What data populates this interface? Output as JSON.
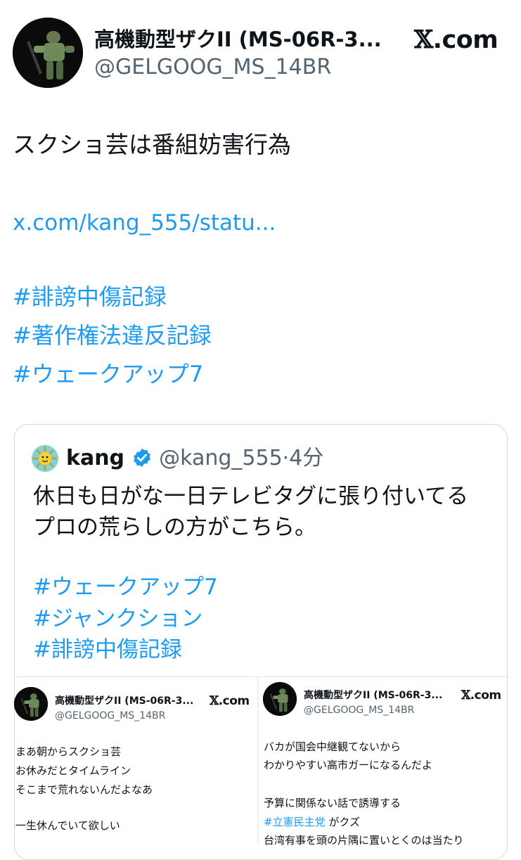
{
  "main_post": {
    "display_name": "高機動型ザクII (MS-06R-3...",
    "handle": "@GELGOOG_MS_14BR",
    "source_brand": ".com",
    "text": "スクショ芸は番組妨害行為",
    "link": "x.com/kang_555/statu...",
    "hashtags": [
      "#誹謗中傷記録",
      "#著作権法違反記録",
      "#ウェークアップ7"
    ]
  },
  "quote": {
    "display_name": "kang",
    "handle": "@kang_555",
    "separator": "·",
    "time": "4分",
    "lines": [
      "休日も日がな一日テレビタグに張り付いてる",
      "プロの荒らしの方がこちら。"
    ],
    "hashtags": [
      "#ウェークアップ7",
      "#ジャンクション",
      "#誹謗中傷記録"
    ]
  },
  "left_screenshot": {
    "display_name": "高機動型ザクII (MS-06R-3...",
    "handle": "@GELGOOG_MS_14BR",
    "source_brand": ".com",
    "lines": [
      "まあ朝からスクショ芸",
      "お休みだとタイムライン",
      "そこまで荒れないんだよなあ",
      "一生休んでいて欲しい"
    ]
  },
  "right_screenshot": {
    "display_name": "高機動型ザクII (MS-06R-3...",
    "handle": "@GELGOOG_MS_14BR",
    "source_brand": ".com",
    "lines": [
      "バカが国会中継観てないから",
      "わかりやすい高市ガーになるんだよ",
      "予算に関係ない話で誘導する"
    ],
    "hashtag": "#立憲民主党",
    "hashtag_suffix": " がクズ",
    "cut_line": "台湾有事を頭の片隅に置いとくのは当たり"
  },
  "colors": {
    "text": "#0f1419",
    "secondary": "#536471",
    "link": "#1d9bf0",
    "verified": "#1d9bf0",
    "border": "#cfd9de"
  },
  "icons": {
    "verified": "verified-badge-icon",
    "x_logo": "x-logo-icon"
  }
}
